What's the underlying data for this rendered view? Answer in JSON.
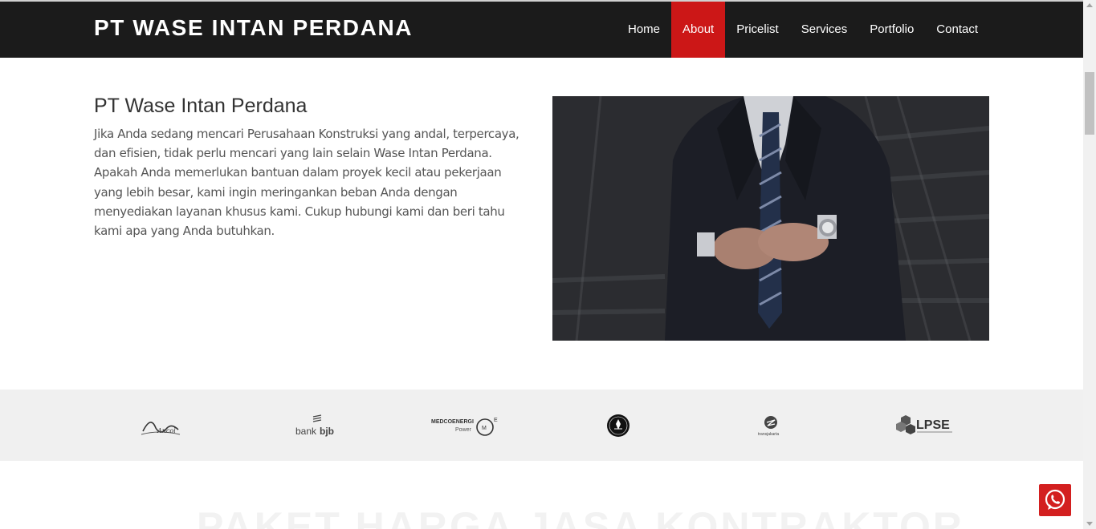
{
  "brand": "PT WASE INTAN PERDANA",
  "nav": [
    {
      "label": "Home"
    },
    {
      "label": "About"
    },
    {
      "label": "Pricelist"
    },
    {
      "label": "Services"
    },
    {
      "label": "Portfolio"
    },
    {
      "label": "Contact"
    }
  ],
  "nav_active": "About",
  "about": {
    "title": "PT Wase Intan Perdana",
    "lines": [
      "Jika Anda sedang mencari Perusahaan Konstruksi yang andal, terpercaya,",
      "dan efisien, tidak perlu mencari yang lain selain Wase Intan Perdana.",
      "Apakah Anda memerlukan bantuan dalam proyek kecil atau pekerjaan",
      "yang lebih besar, kami ingin meringankan beban Anda dengan",
      "menyediakan layanan khusus kami. Cukup hubungi kami dan beri tahu",
      "kami apa yang Anda butuhkan."
    ]
  },
  "partners": {
    "ancol": "Ancol",
    "bjb_prefix": "bank",
    "bjb_name": "bjb",
    "medco_name": "MEDCOENERGI",
    "medco_sub": "Power",
    "transjakarta": "transjakarta",
    "lpse": "LPSE"
  },
  "faded_heading": "PAKET HARGA JASA KONTRAKTOR",
  "colors": {
    "navbar": "#1b1b1b",
    "accent": "#cc1717",
    "partners_bg": "#f0f0f0",
    "whatsapp_button": "#d31f1f"
  },
  "icons": {
    "whatsapp": "whatsapp-icon"
  }
}
